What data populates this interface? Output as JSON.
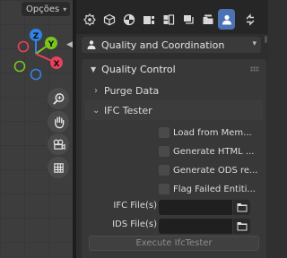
{
  "viewport": {
    "options_label": "Opções",
    "gizmo_axes": {
      "z": "Z",
      "y": "Y",
      "x": "X"
    },
    "tools": [
      {
        "icon": "zoom-icon"
      },
      {
        "icon": "hand-pan-icon"
      },
      {
        "icon": "camera-icon"
      },
      {
        "icon": "grid-icon"
      }
    ]
  },
  "properties": {
    "tabs": [
      {
        "icon": "tool-icon"
      },
      {
        "icon": "object-cube-icon"
      },
      {
        "icon": "render-icon"
      },
      {
        "icon": "output-icon"
      },
      {
        "icon": "scene-icon"
      },
      {
        "icon": "world-icon"
      },
      {
        "icon": "collection-icon"
      },
      {
        "icon": "bim-user-icon",
        "active": true
      },
      {
        "icon": "arrows-icon"
      }
    ],
    "context_select": "Quality and Coordination",
    "section_title": "Quality Control",
    "subpanels": {
      "purge": "Purge Data",
      "ifc_tester": "IFC Tester"
    },
    "checkboxes": [
      {
        "label": "Load from Mem...",
        "checked": false
      },
      {
        "label": "Generate HTML ...",
        "checked": false
      },
      {
        "label": "Generate ODS re...",
        "checked": false
      },
      {
        "label": "Flag Failed Entiti...",
        "checked": false
      }
    ],
    "ifc_files_label": "IFC File(s)",
    "ifc_files_value": "",
    "ids_files_label": "IDS File(s)",
    "ids_files_value": "",
    "execute_label": "Execute IfcTester"
  },
  "colors": {
    "accent": "#4a72b4",
    "axis_x": "#e8425a",
    "axis_y": "#7ac61e",
    "axis_z": "#2f83e6"
  }
}
